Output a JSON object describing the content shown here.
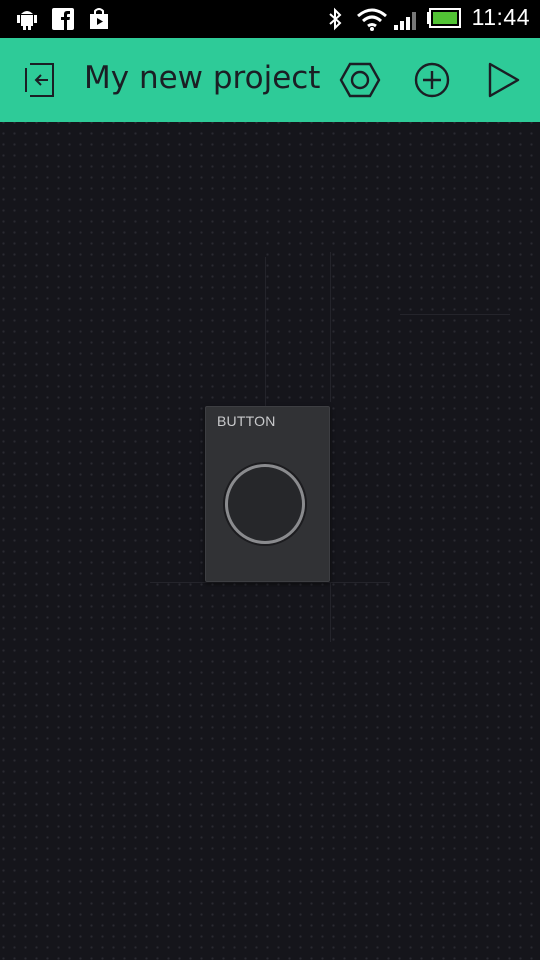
{
  "status_bar": {
    "icons": [
      "android-debug-icon",
      "facebook-icon",
      "play-store-icon",
      "bluetooth-icon",
      "wifi-icon",
      "signal-icon",
      "battery-icon"
    ],
    "time": "11:44"
  },
  "app_bar": {
    "title": "My new project",
    "background_color": "#2ecb98",
    "actions": [
      "back-icon",
      "settings-hexagon-icon",
      "add-widget-icon",
      "play-icon"
    ]
  },
  "canvas": {
    "background_color": "#15151b",
    "widgets": [
      {
        "type": "button",
        "label": "BUTTON"
      }
    ]
  }
}
